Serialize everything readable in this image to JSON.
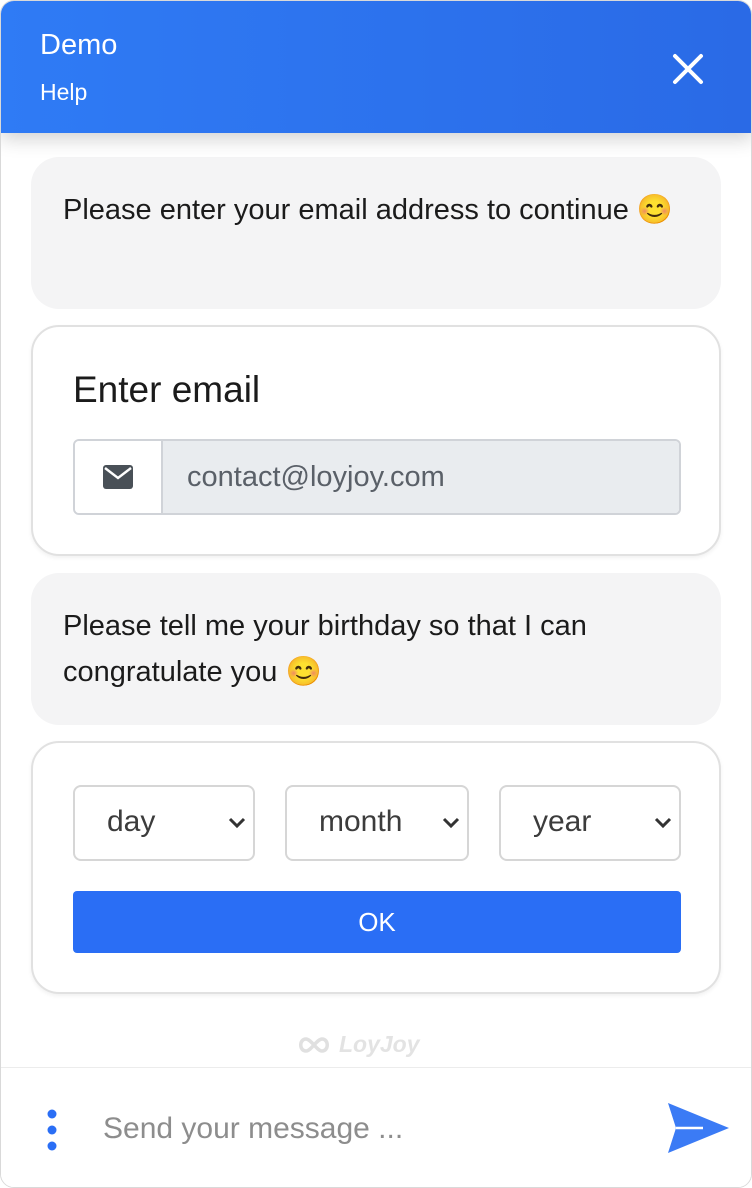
{
  "header": {
    "title": "Demo",
    "subtitle": "Help"
  },
  "messages": [
    {
      "text": "Please enter your email address to continue 😊"
    },
    {
      "text": "Please tell me your birthday so that I can congratulate you 😊"
    }
  ],
  "email_form": {
    "title": "Enter email",
    "value": "contact@loyjoy.com"
  },
  "birthday_form": {
    "day_label": "day",
    "month_label": "month",
    "year_label": "year",
    "ok_label": "OK"
  },
  "branding": {
    "name": "LoyJoy"
  },
  "composer": {
    "placeholder": "Send your message ..."
  },
  "colors": {
    "accent": "#2a6ef5",
    "header": "#2f7bf5"
  }
}
